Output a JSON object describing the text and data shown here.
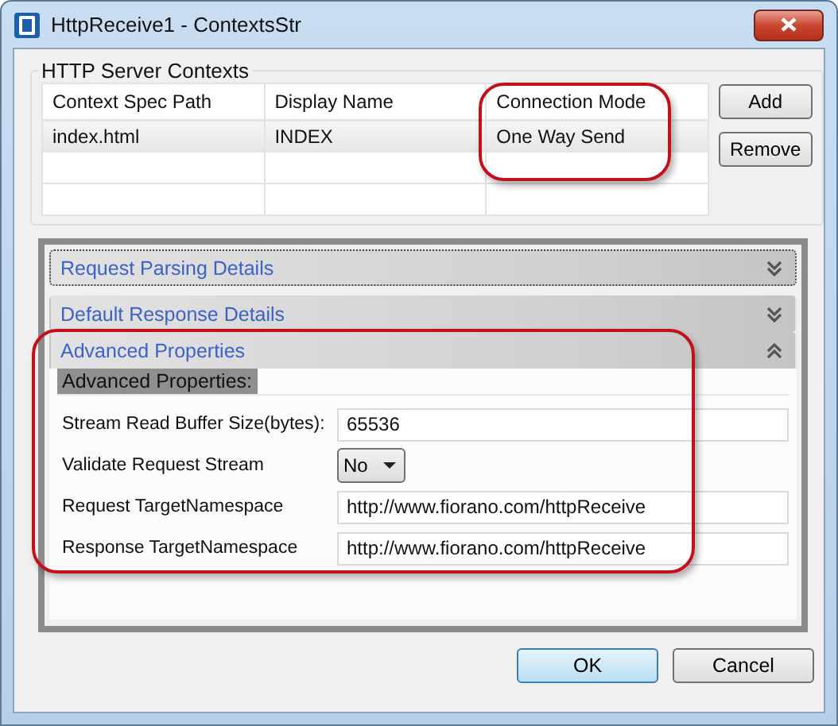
{
  "window": {
    "title": "HttpReceive1 - ContextsStr"
  },
  "contexts": {
    "title": "HTTP Server Contexts",
    "columns": [
      "Context Spec Path",
      "Display Name",
      "Connection Mode"
    ],
    "rows": [
      {
        "cells": [
          "index.html",
          "INDEX",
          "One Way Send"
        ],
        "selected": true
      }
    ],
    "buttons": [
      "Add",
      "Remove"
    ]
  },
  "sections": [
    {
      "title": "Request Parsing Details",
      "expanded": false,
      "focused": true
    },
    {
      "title": "Default Response Details",
      "expanded": false,
      "focused": false
    },
    {
      "title": "Advanced Properties",
      "expanded": true,
      "focused": false,
      "group_label": "Advanced Properties:",
      "fields": [
        {
          "kind": "text",
          "label": "Stream Read Buffer Size(bytes):",
          "value": "65536"
        },
        {
          "kind": "dropdown",
          "label": "Validate Request Stream",
          "value": "No"
        },
        {
          "kind": "text",
          "label": "Request TargetNamespace",
          "value": "http://www.fiorano.com/httpReceive"
        },
        {
          "kind": "text",
          "label": "Response TargetNamespace",
          "value": "http://www.fiorano.com/httpReceive"
        }
      ]
    }
  ],
  "dialog_buttons": [
    {
      "label": "OK",
      "default": true
    },
    {
      "label": "Cancel",
      "default": false
    }
  ]
}
